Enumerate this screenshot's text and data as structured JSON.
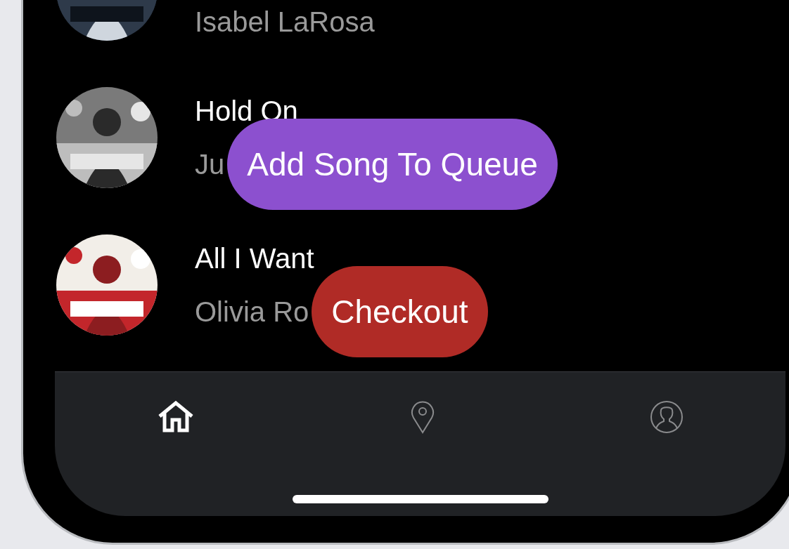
{
  "songs": [
    {
      "artist": "Isabel LaRosa"
    },
    {
      "title": "Hold On",
      "artist": "Ju",
      "action": {
        "kind": "queue",
        "label": "Add Song To Queue"
      }
    },
    {
      "title": "All I Want",
      "artist": "Olivia Ro",
      "action": {
        "kind": "checkout",
        "label": "Checkout"
      }
    }
  ],
  "tab_bar": [
    {
      "kind": "home",
      "selected": true
    },
    {
      "kind": "location",
      "selected": false
    },
    {
      "kind": "profile",
      "selected": false
    }
  ]
}
